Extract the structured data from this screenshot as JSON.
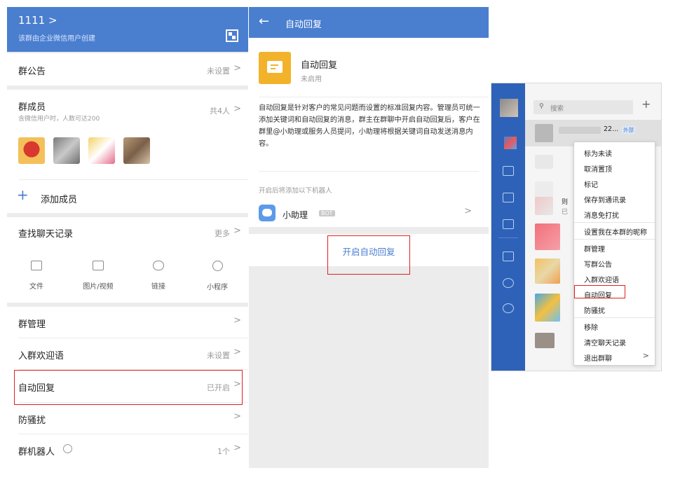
{
  "left": {
    "group_name": "1111 >",
    "group_sub": "该群由企业微信用户创建",
    "announcement": {
      "label": "群公告",
      "value": "未设置"
    },
    "members": {
      "label": "群成员",
      "value": "共4人",
      "sub": "含微信用户时，人数可达200"
    },
    "add_member": "添加成员",
    "search_history": {
      "label": "查找聊天记录",
      "value": "更多"
    },
    "file_types": [
      "文件",
      "图片/视频",
      "链接",
      "小程序"
    ],
    "rows": [
      {
        "label": "群管理",
        "value": ""
      },
      {
        "label": "入群欢迎语",
        "value": "未设置"
      },
      {
        "label": "自动回复",
        "value": "已开启"
      },
      {
        "label": "防骚扰",
        "value": ""
      },
      {
        "label": "群机器人",
        "value": "1个"
      }
    ]
  },
  "mid": {
    "header_title": "自动回复",
    "card_title": "自动回复",
    "card_status": "未启用",
    "description": "自动回复是针对客户的常见问题而设置的标准回复内容。管理员可统一添加关键词和自动回复的消息，群主在群聊中开启自动回复后，客户在群里@小助理或服务人员提问，小助理将根据关键词自动发送消息内容。",
    "robots_hint": "开启后将添加以下机器人",
    "robot_name": "小助理",
    "robot_badge": "BOT",
    "enable_button": "开启自动回复"
  },
  "right": {
    "search_placeholder": "搜索",
    "chat_title": "22...",
    "chat_tag": "外部",
    "partial_texts": [
      "则",
      "已"
    ],
    "menu": [
      "标为未读",
      "取消置顶",
      "标记",
      "保存到通讯录",
      "消息免打扰",
      "设置我在本群的昵称",
      "群管理",
      "写群公告",
      "入群欢迎语",
      "自动回复",
      "防骚扰",
      "移除",
      "清空聊天记录",
      "退出群聊"
    ]
  },
  "colors": {
    "header_blue": "#4a7ecf",
    "sidebar_blue": "#2e62b8",
    "highlight_red": "#e02020",
    "icon_yellow": "#f2b32b"
  }
}
